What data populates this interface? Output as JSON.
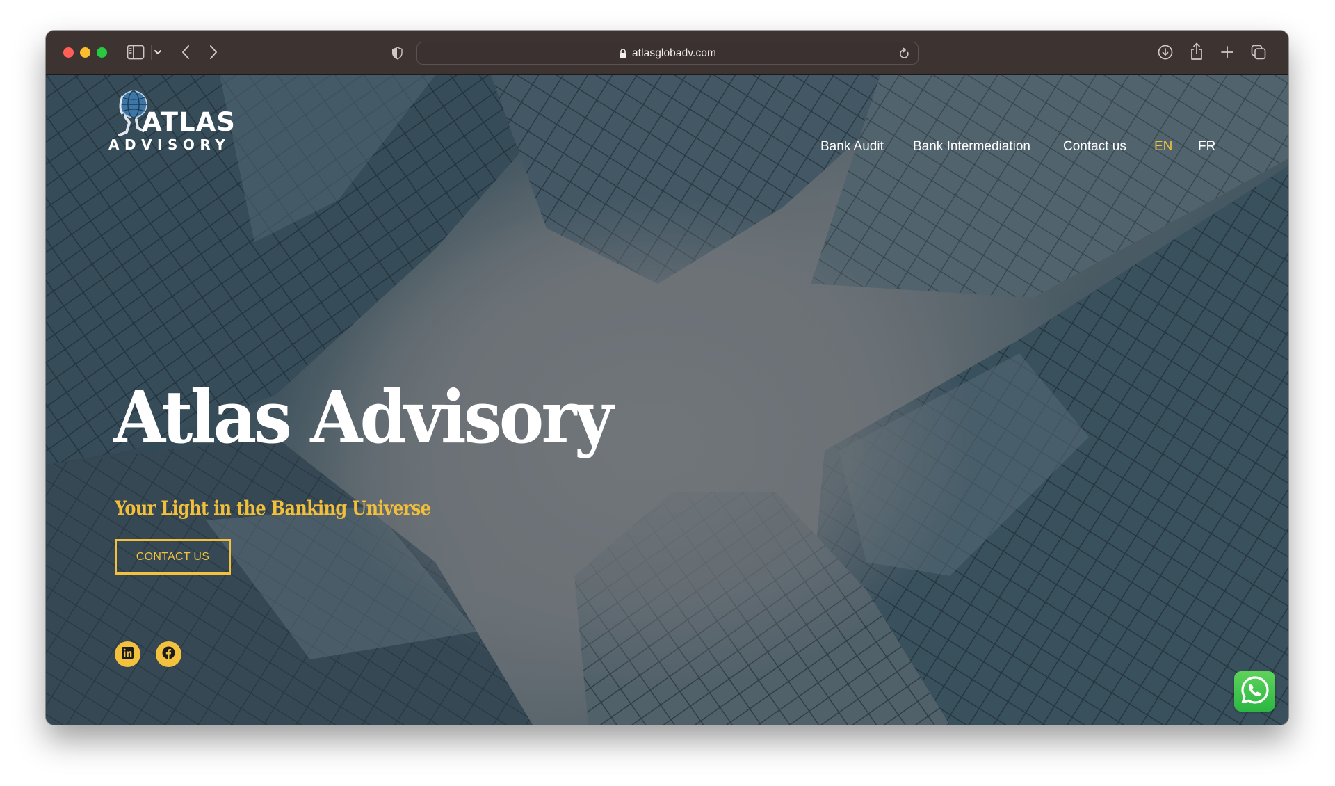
{
  "browser": {
    "url": "atlasglobadv.com",
    "icons": {
      "sidebar": "sidebar-icon",
      "chevron": "chevron-down-icon",
      "back": "chevron-left-icon",
      "forward": "chevron-right-icon",
      "privacy": "shield-icon",
      "lock": "lock-icon",
      "reload": "reload-icon",
      "download": "download-icon",
      "share": "share-icon",
      "new_tab": "plus-icon",
      "tabs": "tabs-overview-icon"
    },
    "traffic_lights": [
      "#fe5f57",
      "#febc2e",
      "#28c840"
    ]
  },
  "site": {
    "logo": {
      "line1": "ATLAS",
      "line2": "ADVISORY"
    },
    "nav": {
      "items": [
        {
          "label": "Bank Audit"
        },
        {
          "label": "Bank Intermediation"
        },
        {
          "label": "Contact us"
        }
      ],
      "languages": [
        {
          "label": "EN",
          "active": true
        },
        {
          "label": "FR",
          "active": false
        }
      ]
    },
    "hero": {
      "title": "Atlas Advisory",
      "subtitle": "Your Light in the Banking Universe",
      "cta_label": "CONTACT US"
    },
    "social": [
      {
        "name": "LinkedIn",
        "icon": "linkedin-icon"
      },
      {
        "name": "Facebook",
        "icon": "facebook-icon"
      }
    ],
    "floating": {
      "name": "WhatsApp",
      "icon": "whatsapp-icon"
    },
    "colors": {
      "accent": "#f2c13e",
      "text": "#ffffff",
      "whatsapp": "#2bb741"
    }
  }
}
